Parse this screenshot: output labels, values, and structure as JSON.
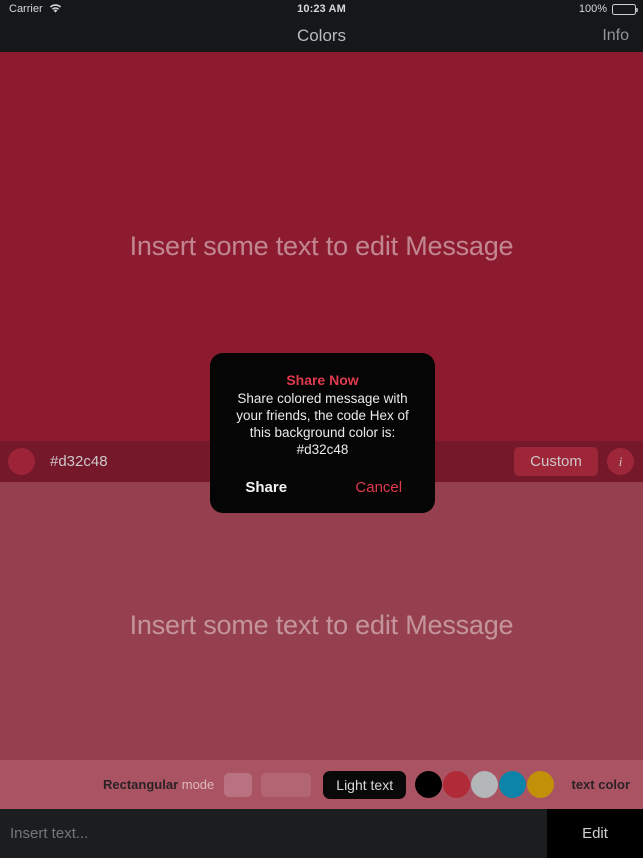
{
  "status_bar": {
    "carrier": "Carrier",
    "wifi_icon": "wifi-icon",
    "time": "10:23 AM",
    "battery_percent": "100%",
    "battery_icon": "battery-full-icon"
  },
  "nav_bar": {
    "title": "Colors",
    "right_action": "Info"
  },
  "canvas": {
    "top_message": "Insert some text to edit Message",
    "bottom_message": "Insert some text to edit Message",
    "top_background": "#8d1b2f",
    "bottom_background": "#96404f"
  },
  "color_bar": {
    "swatch_icon": "color-swatch-circle",
    "hex_value": "#d32c48",
    "custom_label": "Custom",
    "info_label": "i",
    "background": "#74182a"
  },
  "toolbar": {
    "mode_bold": "Rectangular",
    "mode_dim": " mode",
    "light_text_label": "Light text",
    "text_color_label": "text color",
    "shape_swatches": [
      {
        "name": "rounded-square-preview",
        "fill": "rgba(255,255,255,0.18)"
      },
      {
        "name": "rounded-rect-preview",
        "fill": "rgba(255,255,255,0.10)"
      }
    ],
    "text_color_dots": [
      {
        "name": "color-dot-black",
        "hex": "#000000"
      },
      {
        "name": "color-dot-red",
        "hex": "#b02a38"
      },
      {
        "name": "color-dot-silver",
        "hex": "#b4b7b8"
      },
      {
        "name": "color-dot-teal",
        "hex": "#0c83a8"
      },
      {
        "name": "color-dot-gold",
        "hex": "#c3900a"
      }
    ],
    "background": "#aa5463"
  },
  "input_bar": {
    "placeholder": "Insert text...",
    "value": "",
    "edit_label": "Edit"
  },
  "dialog": {
    "title": "Share Now",
    "line1": "Share colored message with",
    "line2": "your friends, the code Hex of",
    "line3": "this background color is:",
    "line4": "#d32c48",
    "confirm_label": "Share",
    "cancel_label": "Cancel",
    "title_color": "#e03a4c",
    "cancel_color": "#e03a4c"
  }
}
